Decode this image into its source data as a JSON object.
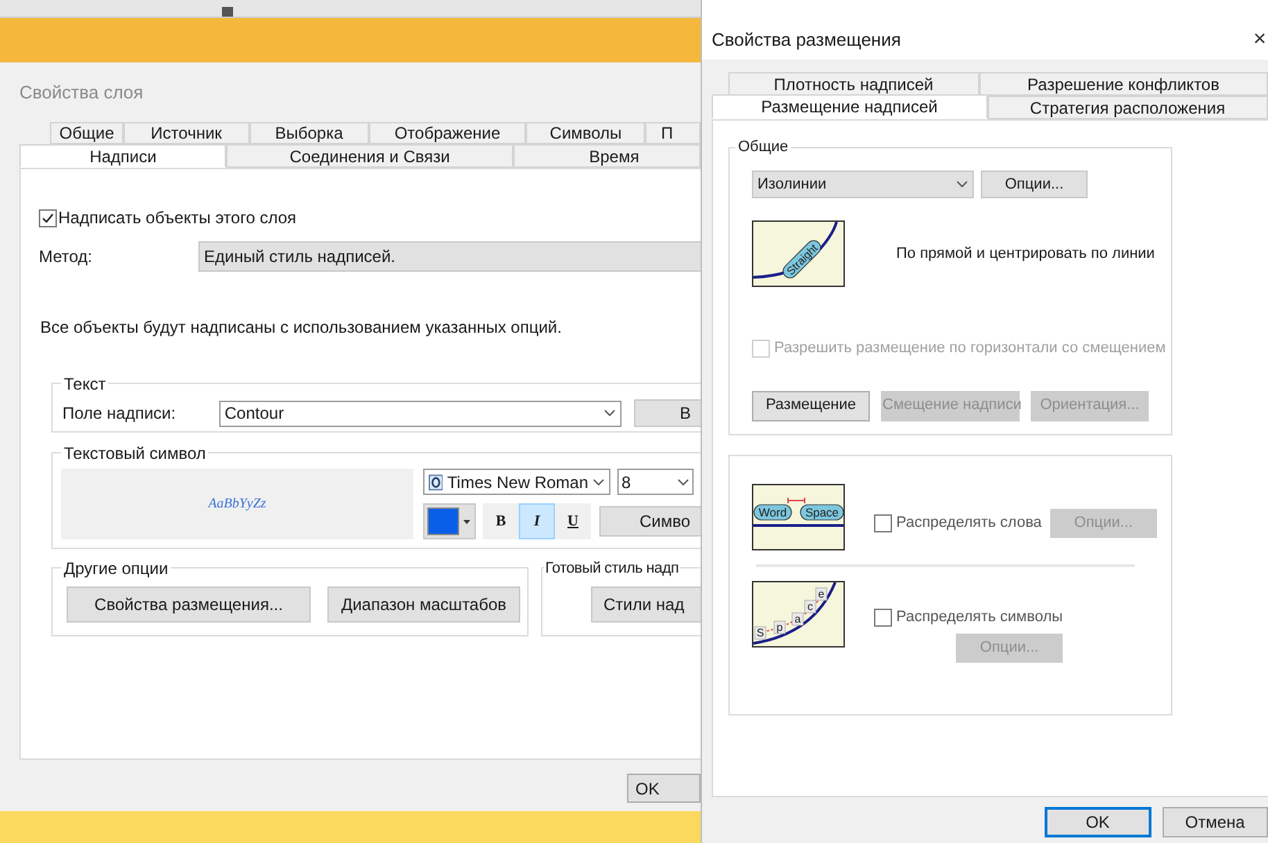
{
  "layer_dialog": {
    "title": "Свойства слоя",
    "tabs_row1": [
      {
        "label": "Общие",
        "selected": false
      },
      {
        "label": "Источник",
        "selected": false
      },
      {
        "label": "Выборка",
        "selected": false
      },
      {
        "label": "Отображение",
        "selected": false
      },
      {
        "label": "Символы",
        "selected": false
      },
      {
        "label": "П",
        "selected": false
      }
    ],
    "tabs_row2": [
      {
        "label": "Надписи",
        "selected": true
      },
      {
        "label": "Соединения и Связи",
        "selected": false
      },
      {
        "label": "Время",
        "selected": false
      }
    ],
    "label_checkbox": {
      "label": "Надписать объекты этого слоя",
      "checked": true
    },
    "method": {
      "label": "Метод:",
      "value": "Единый стиль надписей."
    },
    "description": "Все объекты будут надписаны с использованием указанных опций.",
    "text_group": {
      "title": "Текст",
      "field_label": "Поле надписи:",
      "field_value": "Contour",
      "button": "В"
    },
    "symbol_group": {
      "title": "Текстовый символ",
      "preview": "AaBbYyZz",
      "font": "Times New Roman",
      "size": "8",
      "color": "#0a5fe8",
      "style_buttons": [
        {
          "label": "B",
          "selected": false
        },
        {
          "label": "I",
          "selected": true
        },
        {
          "label": "U",
          "selected": false
        }
      ],
      "button": "Симво"
    },
    "other_group": {
      "title": "Другие опции",
      "buttons": [
        "Свойства размещения...",
        "Диапазон масштабов"
      ]
    },
    "style_group": {
      "title": "Готовый стиль надп",
      "button": "Стили над"
    },
    "ok": "OK"
  },
  "placement_dialog": {
    "title": "Свойства размещения",
    "close": "×",
    "tabs_row1": [
      {
        "label": "Плотность надписей",
        "selected": false
      },
      {
        "label": "Разрешение конфликтов",
        "selected": false
      }
    ],
    "tabs_row2": [
      {
        "label": "Размещение надписей",
        "selected": true
      },
      {
        "label": "Стратегия расположения",
        "selected": false
      }
    ],
    "general": {
      "title": "Общие",
      "dropdown": "Изолинии",
      "options_button": "Опции...",
      "illustration_label": "Straight",
      "caption": "По прямой и центрировать по линии",
      "offset_checkbox": {
        "label": "Разрешить размещение по горизонтали со смещением",
        "checked": false,
        "disabled": true
      },
      "buttons": [
        {
          "label": "Размещение",
          "disabled": false
        },
        {
          "label": "Смещение надписи",
          "disabled": true
        },
        {
          "label": "Ориентация...",
          "disabled": true
        }
      ]
    },
    "spread": [
      {
        "kind": "words",
        "illustration_labels": [
          "Word",
          "Space"
        ],
        "label": "Распределять слова",
        "checked": false,
        "button": {
          "label": "Опции...",
          "disabled": true
        }
      },
      {
        "kind": "chars",
        "illustration_labels": [
          "S",
          "p",
          "a",
          "c",
          "e"
        ],
        "label": "Распределять символы",
        "checked": false,
        "button": {
          "label": "Опции...",
          "disabled": true
        }
      }
    ],
    "buttons": [
      {
        "label": "OK",
        "default": true
      },
      {
        "label": "Отмена",
        "default": false
      }
    ]
  }
}
